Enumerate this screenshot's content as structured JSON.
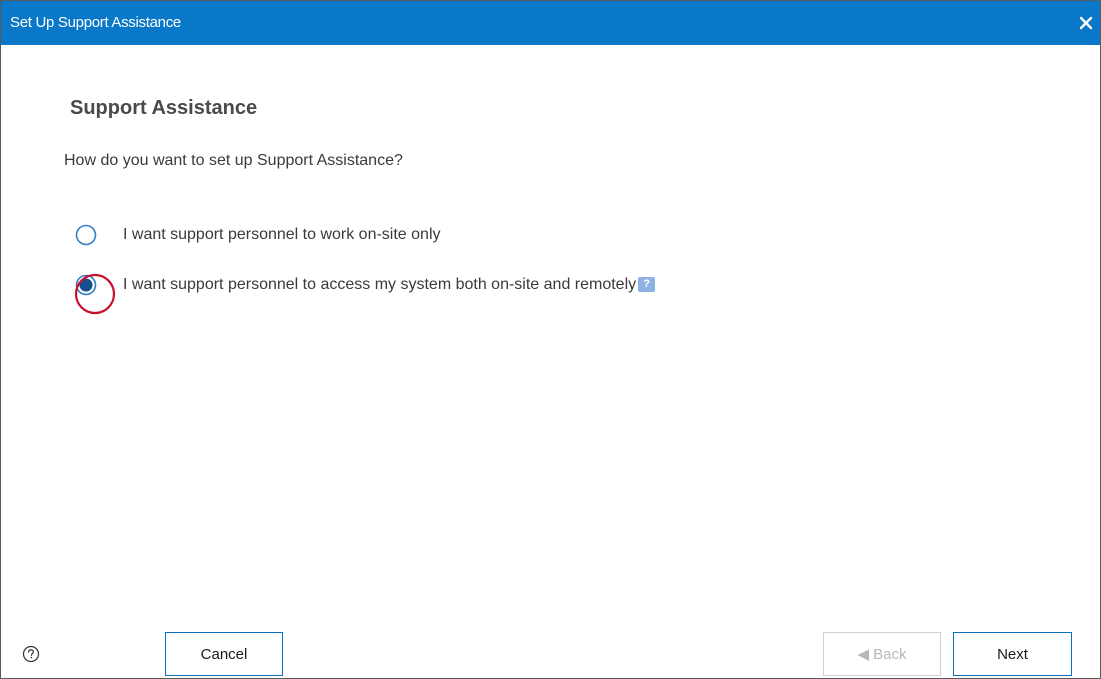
{
  "dialog": {
    "title": "Set Up Support Assistance",
    "close_icon": "close-icon"
  },
  "main": {
    "heading": "Support Assistance",
    "question": "How do you want to set up Support Assistance?",
    "options": [
      {
        "label": "I want support personnel to work on-site only",
        "selected": false
      },
      {
        "label": "I want support personnel to access my system both on-site and remotely",
        "selected": true,
        "help_badge": "?"
      }
    ]
  },
  "footer": {
    "help_icon": "question-circle-icon",
    "cancel_label": "Cancel",
    "back_label": "◀ Back",
    "back_enabled": false,
    "next_label": "Next"
  },
  "colors": {
    "titlebar": "#0a78c8",
    "radio_outline": "#2f7fc4",
    "radio_fill": "#174f8f",
    "highlight_ring": "#c8102e",
    "help_badge": "#8fb2e4"
  }
}
